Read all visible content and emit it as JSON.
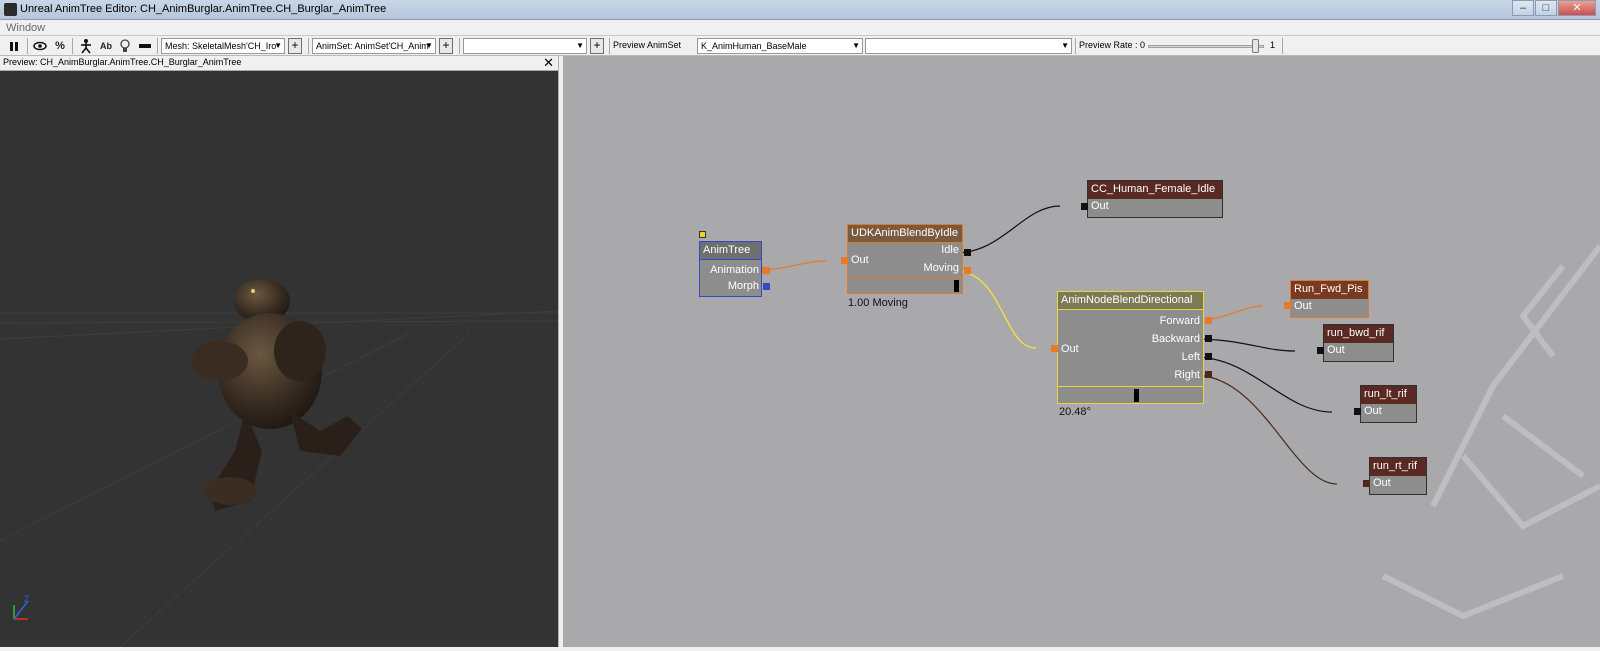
{
  "window": {
    "title": "Unreal AnimTree Editor: CH_AnimBurglar.AnimTree.CH_Burglar_AnimTree",
    "minimize": "–",
    "maximize": "□",
    "close": "✕"
  },
  "menu": {
    "items": [
      "Window"
    ]
  },
  "toolbar": {
    "pause_icon": "pause-icon",
    "eye_icon": "eye-icon",
    "percent_label": "%",
    "skeleton_icon": "skeleton-icon",
    "ab_label": "Ab",
    "bulb_icon": "bulb-icon",
    "bar_icon": "bar-icon",
    "mesh_combo": "Mesh: SkeletalMesh'CH_Iro",
    "animset_combo": "AnimSet: AnimSet'CH_Anim",
    "empty_combo": "",
    "preview_animset_label": "Preview AnimSet",
    "preview_animset_value": "K_AnimHuman_BaseMale",
    "second_combo": "",
    "preview_rate_label": "Preview Rate : 0",
    "preview_rate_max": "1",
    "preview_rate_value": 1.0
  },
  "preview": {
    "title": "Preview: CH_AnimBurglar.AnimTree.CH_Burglar_AnimTree",
    "close": "✕",
    "axis_z": "Z"
  },
  "colors": {
    "canvas_bg": "#a9a8ab",
    "animtree_border": "#3747c8",
    "blend_idle_border": "#e07a2a",
    "blend_dir_border": "#e8d53a",
    "anim_seq_head": "#5a2a22",
    "wire_orange": "#e8782a",
    "wire_yellow": "#f0e040",
    "wire_black": "#111111",
    "wire_brown": "#4a2a18"
  },
  "graph": {
    "animtree": {
      "title": "AnimTree",
      "pins": [
        "Animation",
        "Morph"
      ]
    },
    "blend_by_idle": {
      "title": "UDKAnimBlendByIdle",
      "in": "Out",
      "pins": [
        "Idle",
        "Moving"
      ],
      "status": "1.00 Moving"
    },
    "blend_directional": {
      "title": "AnimNodeBlendDirectional",
      "in": "Out",
      "pins": [
        "Forward",
        "Backward",
        "Left",
        "Right"
      ],
      "status": "20.48°"
    },
    "sequences": [
      {
        "title": "CC_Human_Female_Idle",
        "out": "Out"
      },
      {
        "title": "Run_Fwd_Pis",
        "out": "Out"
      },
      {
        "title": "run_bwd_rif",
        "out": "Out"
      },
      {
        "title": "run_lt_rif",
        "out": "Out"
      },
      {
        "title": "run_rt_rif",
        "out": "Out"
      }
    ]
  }
}
